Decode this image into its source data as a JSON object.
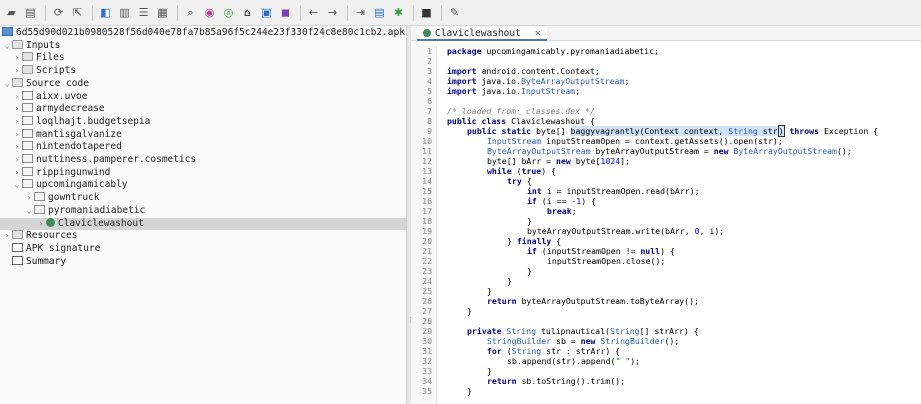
{
  "toolbar": {
    "icons": [
      "open-file-icon",
      "save-all-icon",
      "sync-icon",
      "export-icon",
      "back-view-icon",
      "forward-view-icon",
      "text-search-icon",
      "class-search-icon",
      "search-icon",
      "find-usages-icon",
      "find-class-icon",
      "home-icon",
      "decompile-icon",
      "smali-icon",
      "nav-back-icon",
      "nav-forward-icon",
      "quick-open-icon",
      "log-icon",
      "bug-icon",
      "stop-icon",
      "preferences-icon"
    ]
  },
  "tree": {
    "root": "6d55d90d021b0980528f56d040e78fa7b85a96f5c244e23f330f24c8e80c1cb2.apk",
    "inputs": "Inputs",
    "files": "Files",
    "scripts": "Scripts",
    "source_code": "Source code",
    "packages": [
      "aixx.uvoe",
      "armydecrease",
      "loqlhajt.budgetsepia",
      "mantisgalvanize",
      "nintendotapered",
      "nuttiness.pamperer.cosmetics",
      "rippingunwind",
      "upcomingamicably"
    ],
    "subpackages": [
      "gowntruck",
      "pyromaniadiabetic"
    ],
    "selected_class": "Claviclewashout",
    "resources": "Resources",
    "apk_signature": "APK signature",
    "summary": "Summary"
  },
  "editor": {
    "tab_label": "Claviclewashout",
    "close_glyph": "×",
    "line_numbers": [
      "1",
      "2",
      "3",
      "4",
      "5",
      "6",
      "7",
      "8",
      "9",
      "10",
      "11",
      "12",
      "13",
      "14",
      "15",
      "16",
      "17",
      "18",
      "19",
      "20",
      "21",
      "22",
      "23",
      "24",
      "25",
      "26",
      "27",
      "28",
      "29",
      "30",
      "31",
      "32",
      "33",
      "34",
      "35"
    ],
    "code": {
      "l1_kw": "package",
      "l1_rest": " upcomingamicably.pyromaniadiabetic;",
      "l3_kw": "import",
      "l3_rest": " android.content.Context;",
      "l4_kw": "import",
      "l4_a": " java.io.",
      "l4_ty": "ByteArrayOutputStream",
      "l4_b": ";",
      "l5_kw": "import",
      "l5_a": " java.io.",
      "l5_ty": "InputStream",
      "l5_b": ";",
      "l7_cm": "/* loaded from: classes.dex */",
      "l8_kw": "public class",
      "l8_rest": " Claviclewashout {",
      "l9_kw": "public static",
      "l9_a": " byte[] ",
      "l9_hl": "baggyvagrantly",
      "l9_b": "(Context context, ",
      "l9_ty": "String",
      "l9_c": " str",
      "l9_cur": ")",
      "l9_kw2": " throws",
      "l9_d": " Exception {",
      "l10_ty": "InputStream",
      "l10_rest": " inputStreamOpen = context.getAssets().open(str);",
      "l11_ty": "ByteArrayOutputStream",
      "l11_a": " byteArrayOutputStream = ",
      "l11_kw": "new",
      "l11_ty2": " ByteArrayOutputStream",
      "l11_b": "();",
      "l12_a": "byte[] bArr = ",
      "l12_kw": "new",
      "l12_b": " byte[",
      "l12_nm": "1024",
      "l12_c": "];",
      "l13_kw": "while",
      "l13_a": " (",
      "l13_kw2": "true",
      "l13_b": ") {",
      "l14_kw": "try",
      "l14_rest": " {",
      "l15_kw": "int",
      "l15_rest": " i = inputStreamOpen.read(bArr);",
      "l16_kw": "if",
      "l16_a": " (i == ",
      "l16_nm": "-1",
      "l16_b": ") {",
      "l17_kw": "break",
      "l17_rest": ";",
      "l18": "}",
      "l19_a": "byteArrayOutputStream.write(bArr, ",
      "l19_nm": "0",
      "l19_b": ", i);",
      "l20_a": "} ",
      "l20_kw": "finally",
      "l20_b": " {",
      "l21_kw": "if",
      "l21_a": " (inputStreamOpen != ",
      "l21_kw2": "null",
      "l21_b": ") {",
      "l22": "inputStreamOpen.close();",
      "l23": "}",
      "l24": "}",
      "l25": "}",
      "l26_kw": "return",
      "l26_rest": " byteArrayOutputStream.toByteArray();",
      "l27": "}",
      "l29_kw": "private",
      "l29_ty": " String",
      "l29_a": " tulipnautical(",
      "l29_ty2": "String",
      "l29_b": "[] strArr) {",
      "l30_ty": "StringBuilder",
      "l30_a": " sb = ",
      "l30_kw": "new",
      "l30_ty2": " StringBuilder",
      "l30_b": "();",
      "l31_kw": "for",
      "l31_a": " (",
      "l31_ty": "String",
      "l31_b": " str : strArr) {",
      "l32_a": "sb.append(str).append(",
      "l32_st": "\" \"",
      "l32_b": ");",
      "l33": "}",
      "l34_kw": "return",
      "l34_rest": " sb.toString().trim();",
      "l35": "}"
    }
  }
}
